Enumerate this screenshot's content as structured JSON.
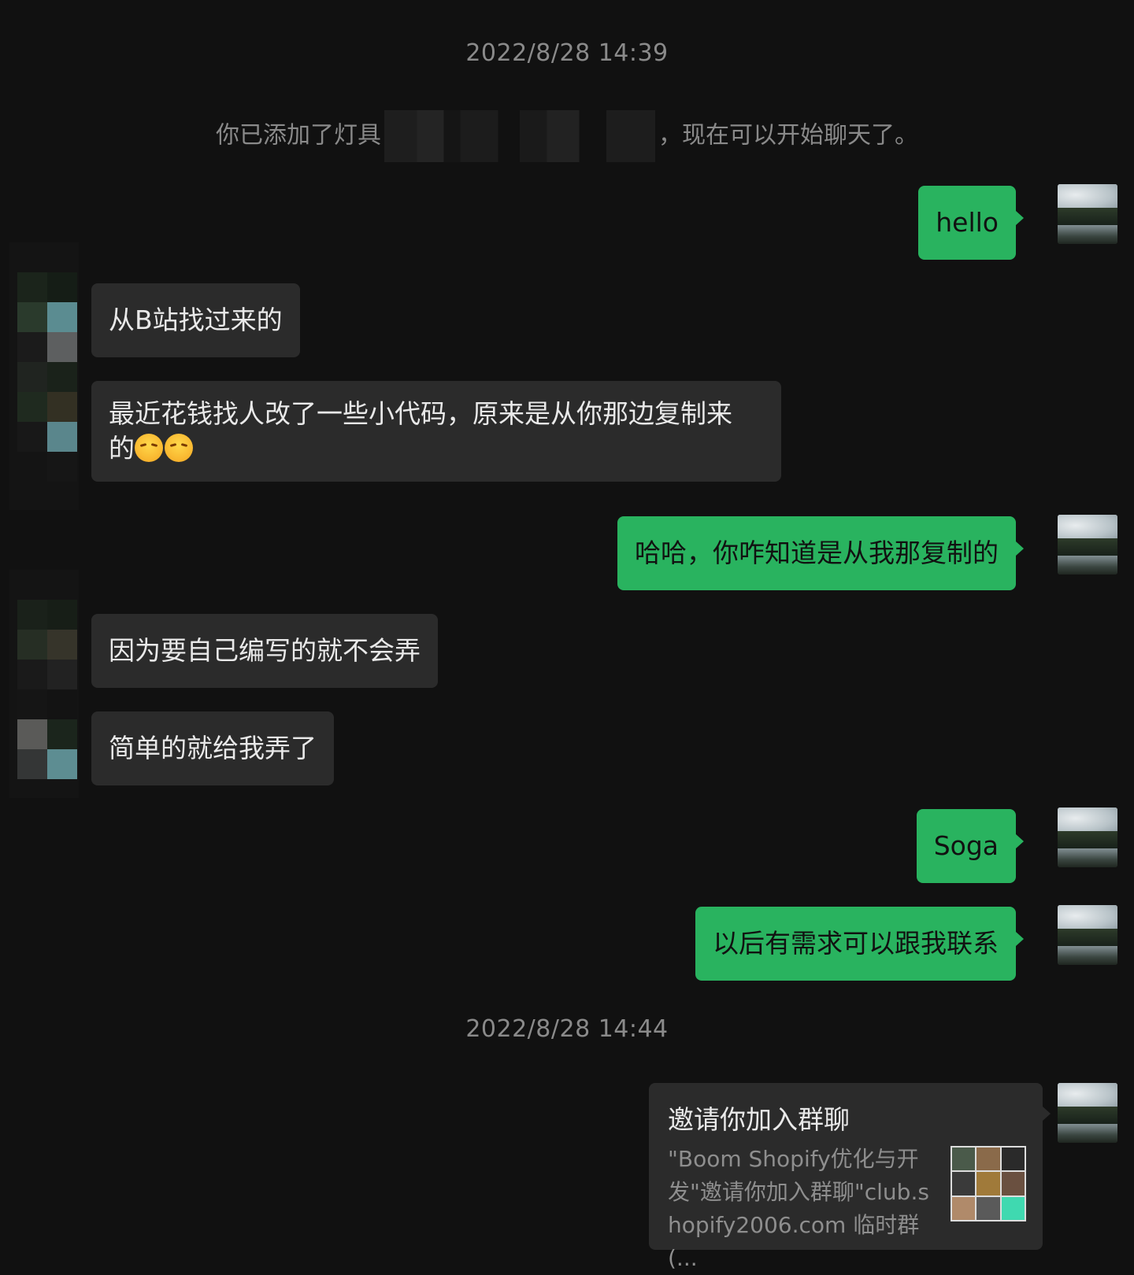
{
  "chat": {
    "timestamp_1": "2022/8/28 14:39",
    "system_prefix": "你已添加了灯具",
    "system_suffix": "，现在可以开始聊天了。",
    "timestamp_2": "2022/8/28 14:44",
    "messages": [
      {
        "side": "out",
        "text": "hello"
      },
      {
        "side": "in",
        "text": "从B站找过来的"
      },
      {
        "side": "in",
        "text": "最近花钱找人改了一些小代码，原来是从你那边复制来",
        "text2": "的"
      },
      {
        "side": "out",
        "text": "哈哈，你咋知道是从我那复制的"
      },
      {
        "side": "in",
        "text": "因为要自己编写的就不会弄"
      },
      {
        "side": "in",
        "text": "简单的就给我弄了"
      },
      {
        "side": "out",
        "text": "Soga"
      },
      {
        "side": "out",
        "text": "以后有需求可以跟我联系"
      }
    ],
    "invite_card": {
      "title": "邀请你加入群聊",
      "line1": "\"Boom  Shopify优化与开",
      "line2": "发\"邀请你加入群聊\"club.s",
      "line3": "hopify2006.com 临时群 (..."
    }
  },
  "icons": {
    "self_avatar": "landscape-avatar",
    "other_avatar": "pixelated-avatar",
    "emoji": "sleepy-face-emoji"
  },
  "colors": {
    "background": "#111111",
    "outgoing_bubble": "#29b35f",
    "incoming_bubble": "#2b2b2b",
    "meta_text": "#8a8a8a"
  }
}
